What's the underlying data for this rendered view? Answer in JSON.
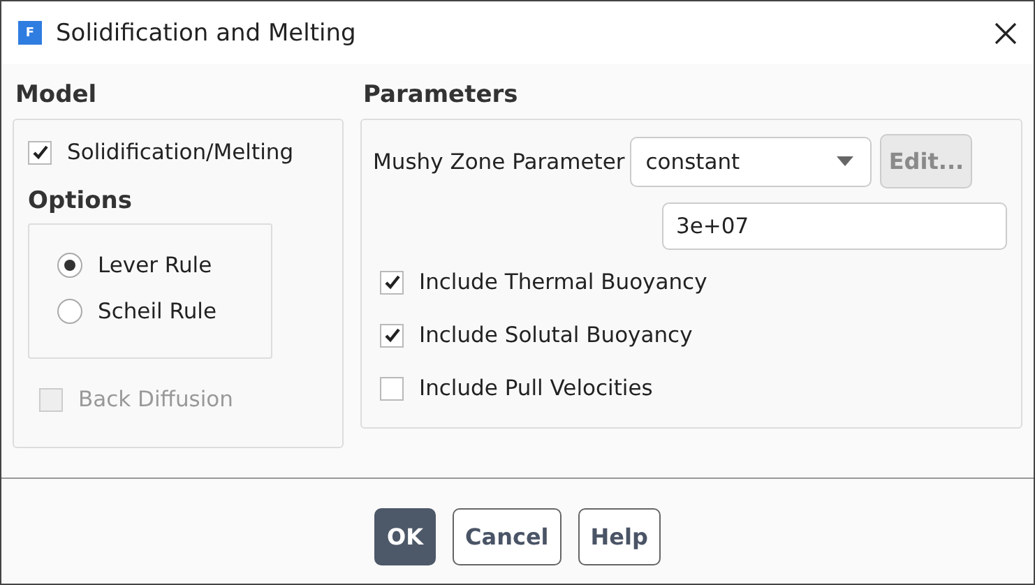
{
  "window": {
    "icon_text": "F",
    "title": "Solidification and Melting"
  },
  "model": {
    "heading": "Model",
    "solidification_melting": {
      "label": "Solidification/Melting",
      "checked": true
    },
    "options": {
      "heading": "Options",
      "rules": [
        {
          "label": "Lever Rule",
          "selected": true
        },
        {
          "label": "Scheil Rule",
          "selected": false
        }
      ]
    },
    "back_diffusion": {
      "label": "Back Diffusion",
      "checked": false,
      "disabled": true
    }
  },
  "parameters": {
    "heading": "Parameters",
    "mushy_zone": {
      "label": "Mushy Zone Parameter",
      "method": "constant",
      "edit_button": {
        "label": "Edit...",
        "disabled": true
      },
      "value": "3e+07"
    },
    "options": [
      {
        "label": "Include Thermal Buoyancy",
        "checked": true
      },
      {
        "label": "Include Solutal Buoyancy",
        "checked": true
      },
      {
        "label": "Include Pull Velocities",
        "checked": false
      }
    ]
  },
  "buttons": [
    {
      "label": "OK",
      "default": true
    },
    {
      "label": "Cancel",
      "default": false
    },
    {
      "label": "Help",
      "default": false
    }
  ]
}
